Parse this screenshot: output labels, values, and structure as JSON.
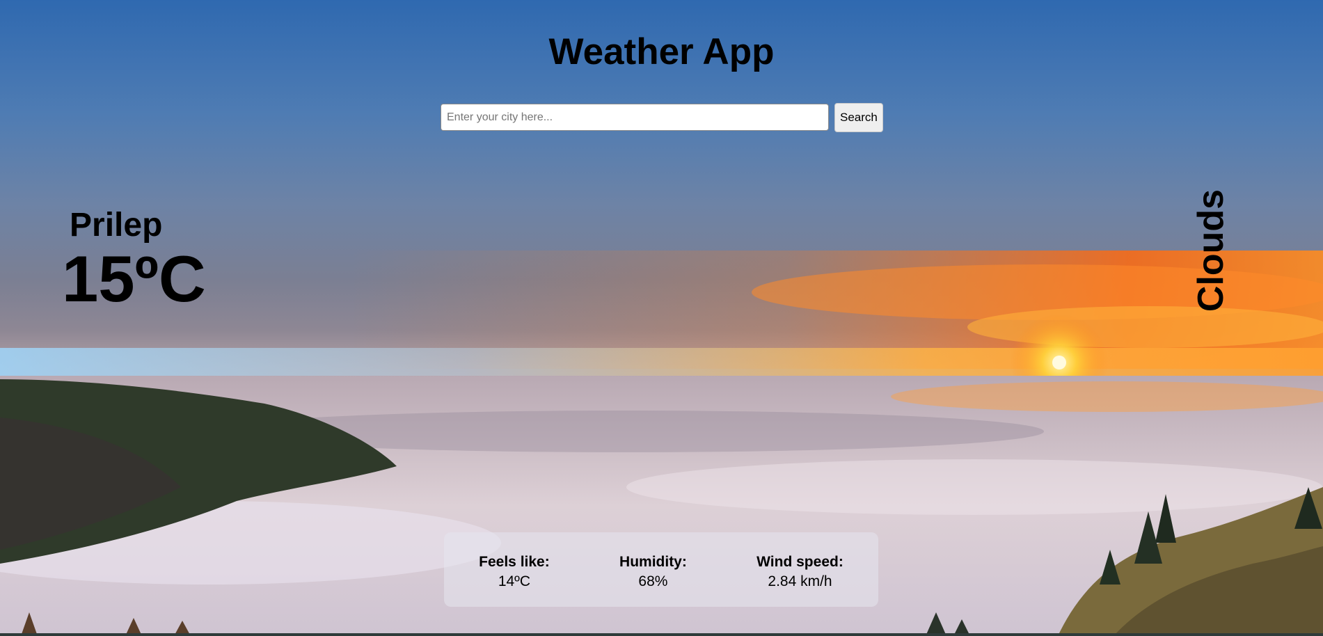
{
  "app": {
    "title": "Weather App"
  },
  "search": {
    "placeholder": "Enter your city here...",
    "value": "",
    "button_label": "Search"
  },
  "current": {
    "city": "Prilep",
    "temperature": "15ºC",
    "condition": "Clouds"
  },
  "details": [
    {
      "label": "Feels like:",
      "value": "14ºC"
    },
    {
      "label": "Humidity:",
      "value": "68%"
    },
    {
      "label": "Wind speed:",
      "value": "2.84 km/h"
    }
  ],
  "background": {
    "scene": "sunset-over-clouds",
    "colors": {
      "sky_top": "#2f69b0",
      "sunset": "#ff7a1a",
      "sun": "#ffe15a",
      "clouds": "#d8ccd2",
      "forest": "#2f3a2a"
    }
  }
}
